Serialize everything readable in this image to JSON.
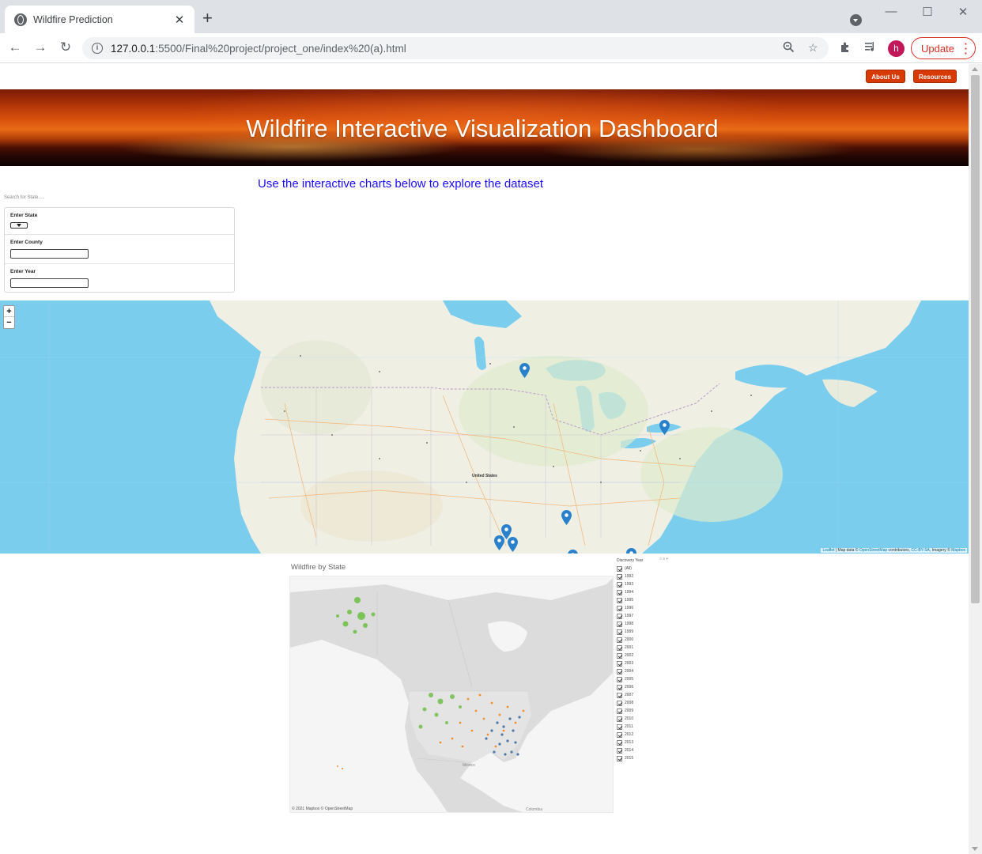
{
  "browser": {
    "tab_title": "Wildfire Prediction",
    "url_host": "127.0.0.1",
    "url_rest": ":5500/Final%20project/project_one/index%20(a).html",
    "profile_initial": "h",
    "update_label": "Update"
  },
  "page": {
    "nav": {
      "about_label": "About Us",
      "resources_label": "Resources"
    },
    "banner_title": "Wildfire Interactive Visualization Dashboard",
    "subtitle": "Use the interactive charts below to explore the dataset",
    "search": {
      "label": "Search for State.....",
      "state_label": "Enter State",
      "county_label": "Enter County",
      "year_label": "Enter Year"
    },
    "leaflet": {
      "zoom_in": "+",
      "zoom_out": "−",
      "attribution_leaflet": "Leaflet",
      "attribution_text": " | Map data © ",
      "attribution_osm": "OpenStreetMap",
      "attribution_contrib": " contributors, ",
      "attribution_license": "CC-BY-SA",
      "attribution_imagery": ", Imagery © ",
      "attribution_mapbox": "Mapbox",
      "country_label": "United States"
    },
    "tableau": {
      "title": "Wildfire by State",
      "credit": "© 2021 Mapbox © OpenStreetMap",
      "map_labels": {
        "mexico": "México",
        "colombia": "Colombia"
      },
      "legend_title": "Discovery Year",
      "legend_items": [
        "(All)",
        "1992",
        "1993",
        "1994",
        "1995",
        "1996",
        "1997",
        "1998",
        "1999",
        "2000",
        "2001",
        "2002",
        "2003",
        "2004",
        "2005",
        "2006",
        "2007",
        "2008",
        "2009",
        "2010",
        "2011",
        "2012",
        "2013",
        "2014",
        "2015"
      ]
    }
  },
  "colors": {
    "button_bg": "#d83a04",
    "subtitle": "#1a0dff",
    "water": "#7bcdee",
    "marker": "#2a81cb",
    "tableau_green": "#7cc35a",
    "tableau_orange": "#f28e2b",
    "tableau_blue": "#4e79a7"
  }
}
